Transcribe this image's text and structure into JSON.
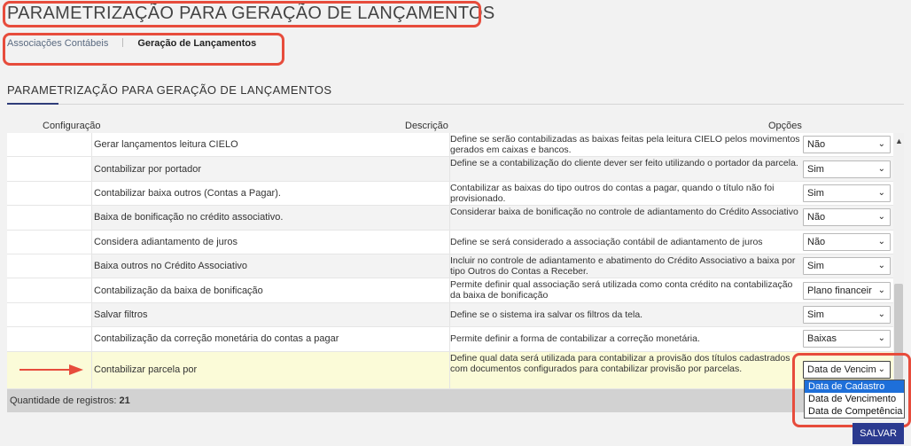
{
  "page": {
    "title": "PARAMETRIZAÇÃO PARA GERAÇÃO DE LANÇAMENTOS"
  },
  "breadcrumb": {
    "items": [
      "Associações Contábeis",
      "Geração de Lançamentos"
    ]
  },
  "section": {
    "title": "PARAMETRIZAÇÃO PARA GERAÇÃO DE LANÇAMENTOS"
  },
  "table": {
    "headers": [
      "Configuração",
      "Descrição",
      "Opções"
    ],
    "rows": [
      {
        "config": "Gerar lançamentos leitura CIELO",
        "description": "Define se serão contabilizadas as baixas feitas pela leitura CIELO pelos movimentos gerados em caixas e bancos.",
        "option": "Não"
      },
      {
        "config": "Contabilizar por portador",
        "description": "Define se a contabilização do cliente dever ser feito utilizando o portador da parcela.",
        "option": "Sim"
      },
      {
        "config": "Contabilizar baixa outros (Contas a Pagar).",
        "description": "Contabilizar as baixas do tipo outros do contas a pagar, quando o título não foi provisionado.",
        "option": "Sim"
      },
      {
        "config": "Baixa de bonificação no crédito associativo.",
        "description": "Considerar baixa de bonificação no controle de adiantamento do Crédito Associativo",
        "option": "Não"
      },
      {
        "config": "Considera adiantamento de juros",
        "description": "Define se será considerado a associação contábil de adiantamento de juros",
        "option": "Não"
      },
      {
        "config": "Baixa outros no Crédito Associativo",
        "description": "Incluir no controle de adiantamento e abatimento do Crédito Associativo a baixa por tipo Outros do Contas a Receber.",
        "option": "Sim"
      },
      {
        "config": "Contabilização da baixa de bonificação",
        "description": "Permite definir qual associação será utilizada como conta crédito na contabilização da baixa de bonificação",
        "option": "Plano financeir"
      },
      {
        "config": "Salvar filtros",
        "description": "Define se o sistema ira salvar os filtros da tela.",
        "option": "Sim"
      },
      {
        "config": "Contabilização da correção monetária do contas a pagar",
        "description": "Permite definir a forma de contabilizar a correção monetária.",
        "option": "Baixas"
      },
      {
        "config": "Contabilizar parcela por",
        "description": "Define qual data será utilizada para contabilizar a provisão dos títulos cadastrados com documentos configurados para contabilizar provisão por parcelas.",
        "option": "Data de Vencim"
      }
    ]
  },
  "dropdown": {
    "options": [
      "Data de Cadastro",
      "Data de Vencimento",
      "Data de Competência"
    ],
    "highlighted": "Data de Cadastro"
  },
  "footer": {
    "count_label": "Quantidade de registros:",
    "count_value": "21"
  },
  "actions": {
    "save_label": "SALVAR"
  },
  "colors": {
    "annotation": "#e74c3c",
    "primary": "#2b3a8f",
    "highlight_row": "#fbfbd8",
    "dropdown_selected": "#1e6fd9"
  },
  "icons": {
    "select_chevron": "chevron-down-icon",
    "scroll_up": "caret-up-icon",
    "annotation_arrow": "arrow-right-icon"
  }
}
